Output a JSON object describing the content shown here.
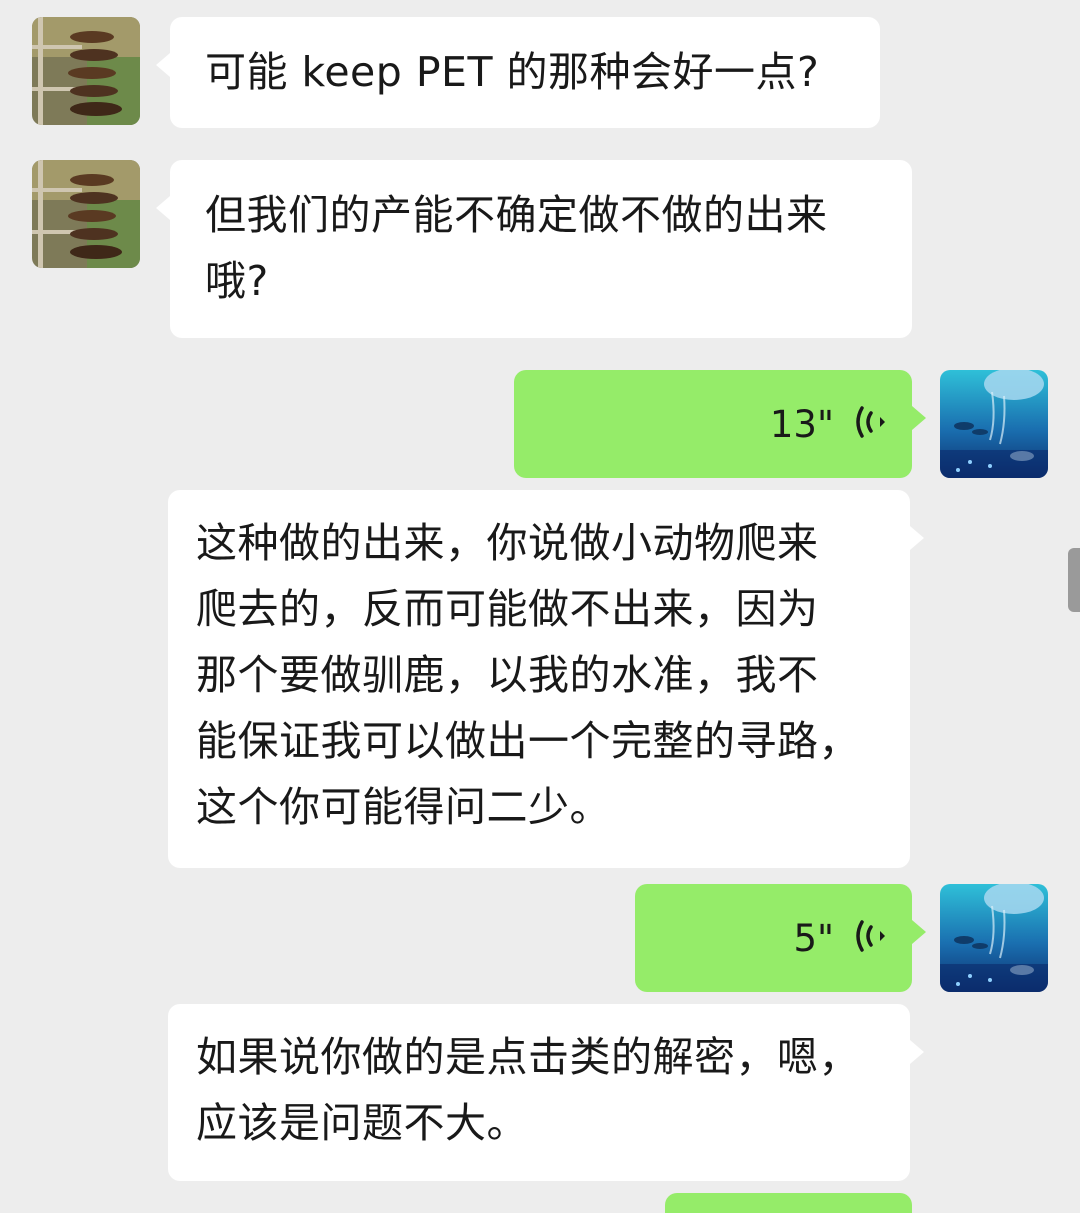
{
  "colors": {
    "background": "#ededed",
    "incoming_bubble": "#ffffff",
    "outgoing_bubble": "#95ec69",
    "text": "#191919"
  },
  "messages": [
    {
      "sender": "other",
      "type": "text",
      "text": "可能 keep PET 的那种会好一点?"
    },
    {
      "sender": "other",
      "type": "text",
      "text": "但我们的产能不确定做不做的出来\n哦?"
    },
    {
      "sender": "me",
      "type": "voice",
      "duration": "13\"",
      "icon": "voice-wave-icon"
    },
    {
      "sender": "me",
      "type": "text",
      "text": "这种做的出来，你说做小动物爬来\n爬去的，反而可能做不出来，因为\n那个要做驯鹿，以我的水准，我不\n能保证我可以做出一个完整的寻路，\n这个你可能得问二少。"
    },
    {
      "sender": "me",
      "type": "voice",
      "duration": "5\"",
      "icon": "voice-wave-icon"
    },
    {
      "sender": "me",
      "type": "text",
      "text": "如果说你做的是点击类的解密，嗯，\n应该是问题不大。"
    }
  ]
}
